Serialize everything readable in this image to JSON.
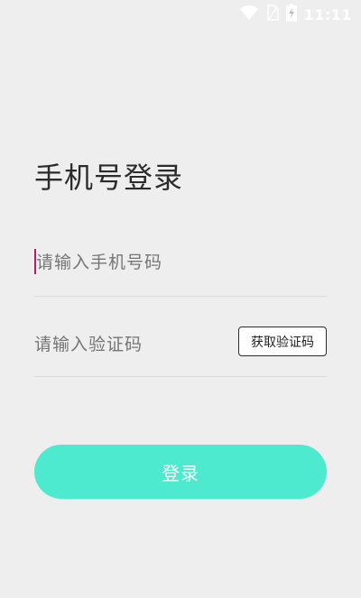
{
  "status_bar": {
    "time": "11:11",
    "icons": [
      "wifi-icon",
      "sim-icon",
      "battery-charging-icon"
    ]
  },
  "page": {
    "title": "手机号登录"
  },
  "phone_field": {
    "placeholder": "请输入手机号码"
  },
  "code_field": {
    "placeholder": "请输入验证码",
    "get_code_label": "获取验证码"
  },
  "login_button": {
    "label": "登录"
  },
  "colors": {
    "background": "#eeeeee",
    "accent": "#4deacf",
    "cursor": "#c2185b"
  }
}
